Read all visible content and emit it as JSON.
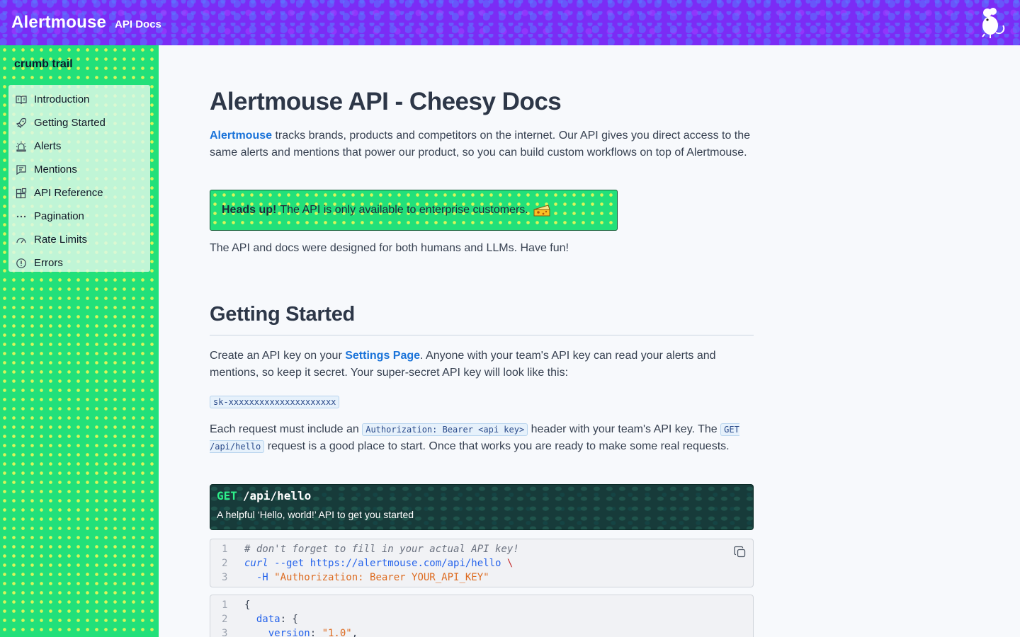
{
  "header": {
    "brand": "Alertmouse",
    "subtitle": "API Docs",
    "logo_icon": "mouse-icon",
    "bg_color": "#7b2cf5"
  },
  "sidebar": {
    "title": "crumb trail",
    "bg_color": "#22e07a",
    "items": [
      {
        "label": "Introduction",
        "icon": "book-open-icon"
      },
      {
        "label": "Getting Started",
        "icon": "rocket-icon"
      },
      {
        "label": "Alerts",
        "icon": "siren-icon"
      },
      {
        "label": "Mentions",
        "icon": "message-icon"
      },
      {
        "label": "API Reference",
        "icon": "blocks-icon"
      },
      {
        "label": "Pagination",
        "icon": "ellipsis-icon"
      },
      {
        "label": "Rate Limits",
        "icon": "gauge-icon"
      },
      {
        "label": "Errors",
        "icon": "alert-circle-icon"
      }
    ]
  },
  "main": {
    "title": "Alertmouse API - Cheesy Docs",
    "intro": {
      "link": "Alertmouse",
      "text": " tracks brands, products and competitors on the internet. Our API gives you direct access to the same alerts and mentions that power our product, so you can build custom workflows on top of Alertmouse."
    },
    "callout": {
      "strong": "Heads up!",
      "text": "The API is only available to enterprise customers.",
      "icon": "cheese-icon"
    },
    "humans_note": "The API and docs were designed for both humans and LLMs. Have fun!",
    "getting_started": {
      "heading": "Getting Started",
      "p1_before": "Create an API key on your ",
      "p1_link": "Settings Page",
      "p1_after": ". Anyone with your team's API key can read your alerts and mentions, so keep it secret. Your super-secret API key will look like this:",
      "key_example": "sk-xxxxxxxxxxxxxxxxxxxxx",
      "p2_a": "Each request must include an ",
      "p2_code1": "Authorization: Bearer <api key>",
      "p2_b": " header with your team's API key. The ",
      "p2_code2": "GET /api/hello",
      "p2_c": " request is a good place to start. Once that works you are ready to make some real requests."
    },
    "endpoint": {
      "method": "GET",
      "path": "/api/hello",
      "description": "A helpful ‘Hello, world!’ API to get you started"
    },
    "code_block_1": {
      "lines": [
        {
          "n": "1",
          "comment": "# don't forget to fill in your actual API key!"
        },
        {
          "n": "2",
          "cmd": "curl",
          "flag": " --get ",
          "url": "https://alertmouse.com/api/hello",
          "bs": " \\"
        },
        {
          "n": "3",
          "flag": "  -H ",
          "str": "\"Authorization: Bearer YOUR_API_KEY\""
        }
      ],
      "copy_icon": "copy-icon"
    },
    "code_block_2": {
      "lines": [
        {
          "n": "1",
          "plain": "{"
        },
        {
          "n": "2",
          "key": "  data",
          "plain": ": {"
        },
        {
          "n": "3",
          "key": "    version",
          "plain": ": ",
          "str": "\"1.0\"",
          "tail": ","
        }
      ]
    }
  }
}
